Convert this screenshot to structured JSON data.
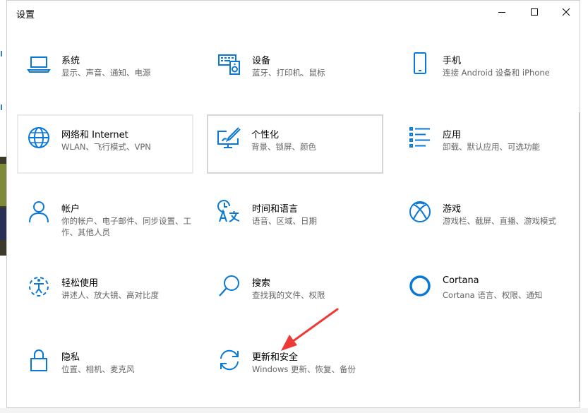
{
  "window": {
    "title": "设置"
  },
  "categories": [
    {
      "name": "系统",
      "desc": "显示、声音、通知、电源",
      "icon": "laptop-icon"
    },
    {
      "name": "设备",
      "desc": "蓝牙、打印机、鼠标",
      "icon": "keyboard-speaker-icon"
    },
    {
      "name": "手机",
      "desc": "连接 Android 设备和 iPhone",
      "icon": "phone-icon"
    },
    {
      "name": "网络和 Internet",
      "desc": "WLAN、飞行模式、VPN",
      "icon": "globe-icon"
    },
    {
      "name": "个性化",
      "desc": "背景、锁屏、颜色",
      "icon": "paint-monitor-icon"
    },
    {
      "name": "应用",
      "desc": "卸载、默认应用、可选功能",
      "icon": "apps-list-icon"
    },
    {
      "name": "帐户",
      "desc": "你的帐户、电子邮件、同步设置、工作、其他人员",
      "icon": "person-icon"
    },
    {
      "name": "时间和语言",
      "desc": "语音、区域、日期",
      "icon": "time-language-icon"
    },
    {
      "name": "游戏",
      "desc": "游戏栏、截屏、直播、游戏模式",
      "icon": "xbox-icon"
    },
    {
      "name": "轻松使用",
      "desc": "讲述人、放大镜、高对比度",
      "icon": "ease-of-access-icon"
    },
    {
      "name": "搜索",
      "desc": "查找我的文件、权限",
      "icon": "search-icon"
    },
    {
      "name": "Cortana",
      "desc": "Cortana 语言、权限、通知",
      "icon": "cortana-icon"
    },
    {
      "name": "隐私",
      "desc": "位置、相机、麦克风",
      "icon": "lock-icon"
    },
    {
      "name": "更新和安全",
      "desc": "Windows 更新、恢复、备份",
      "icon": "update-icon"
    }
  ],
  "colors": {
    "accent": "#0a78d7",
    "annotation_arrow": "#ee3a36"
  }
}
